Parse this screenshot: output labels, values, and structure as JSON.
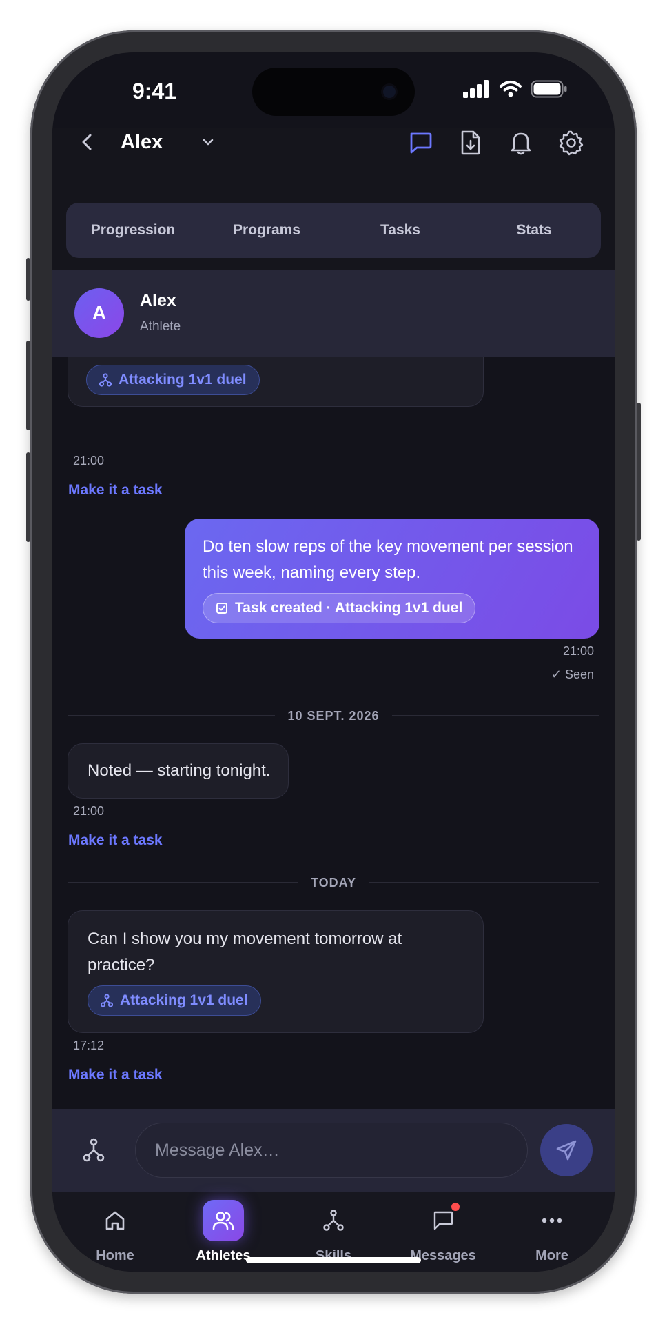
{
  "status": {
    "time": "9:41"
  },
  "header": {
    "title": "Alex"
  },
  "tabs": [
    "Progression",
    "Programs",
    "Tasks",
    "Stats"
  ],
  "athlete": {
    "initial": "A",
    "name": "Alex",
    "role": "Athlete"
  },
  "messages": [
    {
      "direction": "in",
      "chip": "Attacking 1v1 duel",
      "time": "21:00",
      "action": "Make it a task"
    },
    {
      "direction": "out",
      "text": "Do ten slow reps of the key movement per session this week, naming every step.",
      "chip": "Task created · Attacking 1v1 duel",
      "time": "21:00",
      "receipt": "✓ Seen"
    },
    {
      "divider": "10 SEPT. 2026"
    },
    {
      "direction": "in",
      "text": "Noted — starting tonight.",
      "time": "21:00",
      "action": "Make it a task"
    },
    {
      "divider": "TODAY"
    },
    {
      "direction": "in",
      "text": "Can I show you my movement tomorrow at practice?",
      "chip": "Attacking 1v1 duel",
      "time": "17:12",
      "action": "Make it a task"
    }
  ],
  "composer": {
    "placeholder": "Message Alex…"
  },
  "nav": [
    {
      "label": "Home",
      "icon": "home-icon",
      "active": false
    },
    {
      "label": "Athletes",
      "icon": "users-icon",
      "active": true
    },
    {
      "label": "Skills",
      "icon": "skill-tree-icon",
      "active": false
    },
    {
      "label": "Messages",
      "icon": "chat-icon",
      "active": false,
      "badge": true
    },
    {
      "label": "More",
      "icon": "more-icon",
      "active": false
    }
  ],
  "colors": {
    "accent": "#6c78ff",
    "gradient_start": "#6b68f0",
    "gradient_end": "#7b4be6",
    "background": "#13131b"
  }
}
